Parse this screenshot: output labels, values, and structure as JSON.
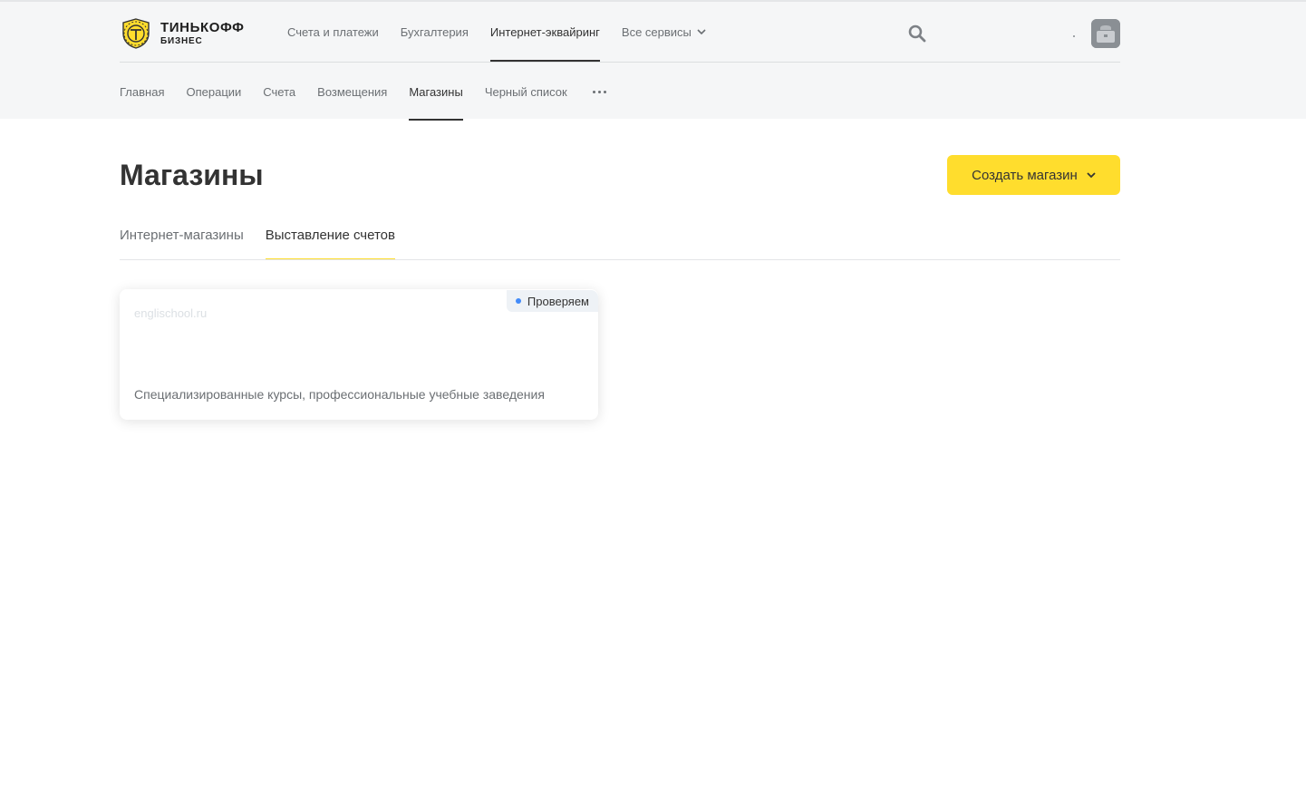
{
  "brand": {
    "name": "ТИНЬКОФФ",
    "sub": "БИЗНЕС"
  },
  "topnav": {
    "items": [
      {
        "label": "Счета и платежи"
      },
      {
        "label": "Бухгалтерия"
      },
      {
        "label": "Интернет-эквайринг",
        "active": true
      },
      {
        "label": "Все сервисы"
      }
    ]
  },
  "subnav": {
    "items": [
      {
        "label": "Главная"
      },
      {
        "label": "Операции"
      },
      {
        "label": "Счета"
      },
      {
        "label": "Возмещения"
      },
      {
        "label": "Магазины",
        "active": true
      },
      {
        "label": "Черный список"
      }
    ]
  },
  "page": {
    "title": "Магазины",
    "create_button": "Создать магазин"
  },
  "tabs": [
    {
      "label": "Интернет-магазины"
    },
    {
      "label": "Выставление счетов",
      "active": true
    }
  ],
  "shop_card": {
    "url": "englischool.ru",
    "status": "Проверяем",
    "description": "Специализированные курсы, профессиональные учебные заведения"
  },
  "colors": {
    "accent": "#ffdd2d",
    "header_bg": "#f5f6f7",
    "status_dot": "#428bf9"
  },
  "icons": [
    "logo-emblem-icon",
    "chevron-down-icon",
    "search-icon",
    "more-dots-icon",
    "avatar-icon"
  ]
}
